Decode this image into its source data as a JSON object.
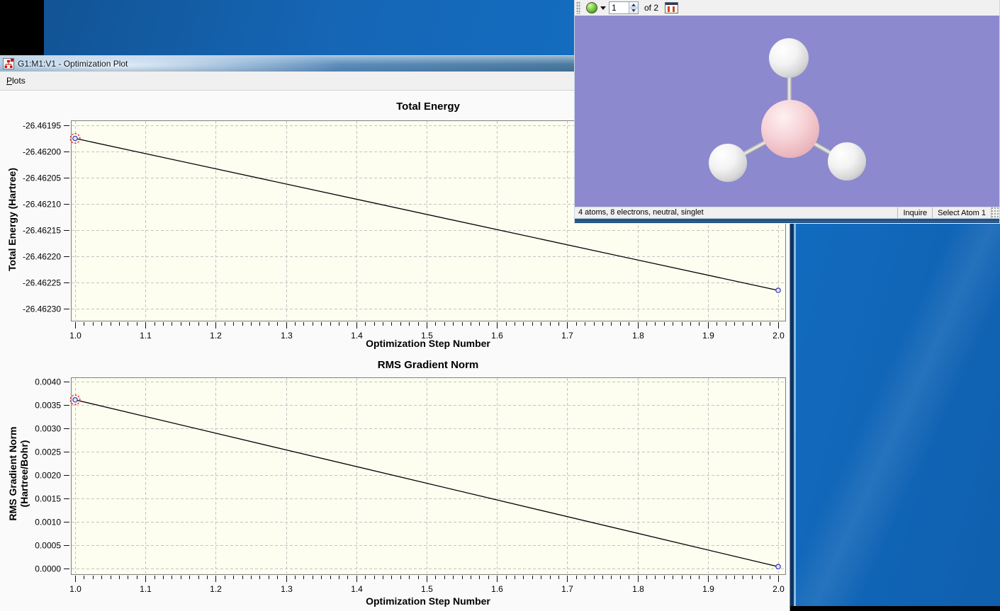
{
  "plot_window": {
    "title": "G1:M1:V1 - Optimization Plot",
    "icon_name": "plot-tree-icon",
    "menu": {
      "plots": {
        "accel": "P",
        "rest": "lots"
      }
    }
  },
  "chart_data": [
    {
      "type": "line",
      "title": "Total Energy",
      "xlabel": "Optimization Step Number",
      "ylabel": "Total Energy (Hartree)",
      "x": [
        1.0,
        2.0
      ],
      "y": [
        -26.461975,
        -26.462265
      ],
      "xlim": [
        1.0,
        2.0
      ],
      "ylim": [
        -26.4623,
        -26.46195
      ],
      "xticks": [
        "1.0",
        "1.1",
        "1.2",
        "1.3",
        "1.4",
        "1.5",
        "1.6",
        "1.7",
        "1.8",
        "1.9",
        "2.0"
      ],
      "yticks": [
        "-26.46195",
        "-26.46200",
        "-26.46205",
        "-26.46210",
        "-26.46215",
        "-26.46220",
        "-26.46225",
        "-26.46230"
      ],
      "x_minor_subdivisions": 8,
      "grid": true,
      "legend": "none",
      "marker": "open-circle",
      "selected_index": 0,
      "plot_bg": "#fdfdf0",
      "grid_color": "#c3c3c3",
      "line_color": "#000000",
      "marker_color": "#3333bb",
      "selected_ring_color": "#dd2222"
    },
    {
      "type": "line",
      "title": "RMS Gradient Norm",
      "xlabel": "Optimization Step Number",
      "ylabel": "RMS Gradient Norm",
      "ylabel_line2": "(Hartree/Bohr)",
      "x": [
        1.0,
        2.0
      ],
      "y": [
        0.00361,
        4e-05
      ],
      "xlim": [
        1.0,
        2.0
      ],
      "ylim": [
        0.0,
        0.004
      ],
      "xticks": [
        "1.0",
        "1.1",
        "1.2",
        "1.3",
        "1.4",
        "1.5",
        "1.6",
        "1.7",
        "1.8",
        "1.9",
        "2.0"
      ],
      "yticks": [
        "0.0040",
        "0.0035",
        "0.0030",
        "0.0025",
        "0.0020",
        "0.0015",
        "0.0010",
        "0.0005",
        "0.0000"
      ],
      "x_minor_subdivisions": 8,
      "grid": true,
      "legend": "none",
      "marker": "open-circle",
      "selected_index": 0,
      "plot_bg": "#fdfdf0",
      "grid_color": "#c3c3c3",
      "line_color": "#000000",
      "marker_color": "#3333bb",
      "selected_ring_color": "#dd2222"
    }
  ],
  "molecule_window": {
    "toolbar": {
      "frame_value": "1",
      "frame_of_label": "of 2",
      "sphere_button": "green-sphere-icon",
      "list_button": "frame-list-icon"
    },
    "view_bg": "#8d89cf",
    "molecule": {
      "center_atom_color": "#f0c2c7",
      "outer_atom_color": "#ececec",
      "bond_color": "#bdbdbd"
    },
    "status": {
      "info": "4 atoms, 8 electrons, neutral, singlet",
      "mode": "Inquire",
      "selection": "Select Atom 1"
    }
  },
  "colors": {
    "desktop_blue": "#1470c6",
    "titlebar_blue": "#5d8fc0",
    "plot_area_ivory": "#fdfdf0",
    "molecule_view_lavender": "#8d89cf"
  }
}
